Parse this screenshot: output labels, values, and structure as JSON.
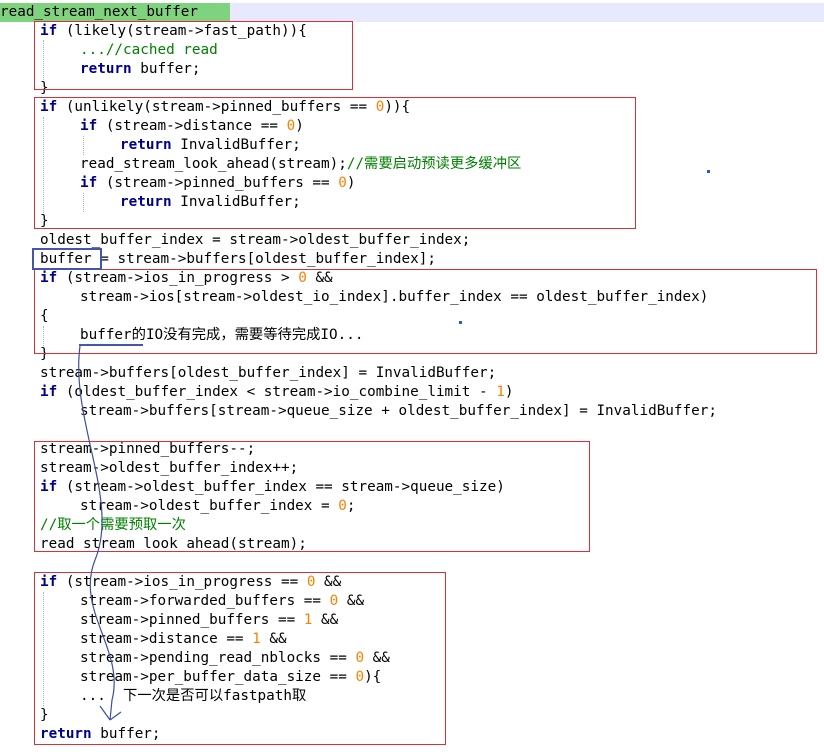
{
  "function_title": "read_stream_next_buffer",
  "lines": {
    "l1": "if (likely(stream->fast_path)){",
    "l2": "...//cached read",
    "l3": "return buffer;",
    "l4": "}",
    "l5": "if (unlikely(stream->pinned_buffers == 0)){",
    "l6": "if (stream->distance == 0)",
    "l7": "return InvalidBuffer;",
    "l8_code": "read_stream_look_ahead(stream);",
    "l8_comment": "//需要启动预读更多缓冲区",
    "l9": "if (stream->pinned_buffers == 0)",
    "l10": "return InvalidBuffer;",
    "l11": "}",
    "l12": "oldest_buffer_index = stream->oldest_buffer_index;",
    "l13": "buffer = stream->buffers[oldest_buffer_index];",
    "l14": "if (stream->ios_in_progress > 0 &&",
    "l15": "stream->ios[stream->oldest_io_index].buffer_index == oldest_buffer_index)",
    "l16": "{",
    "l17": "buffer的IO没有完成，需要等待完成IO...",
    "l18": "}",
    "l19": "stream->buffers[oldest_buffer_index] = InvalidBuffer;",
    "l20": "if (oldest_buffer_index < stream->io_combine_limit - 1)",
    "l21": "stream->buffers[stream->queue_size + oldest_buffer_index] = InvalidBuffer;",
    "l22": "stream->pinned_buffers--;",
    "l23": "stream->oldest_buffer_index++;",
    "l24": "if (stream->oldest_buffer_index == stream->queue_size)",
    "l25": "stream->oldest_buffer_index = 0;",
    "l26": "//取一个需要预取一次",
    "l27": "read_stream_look_ahead(stream);",
    "l28": "if (stream->ios_in_progress == 0 &&",
    "l29": "stream->forwarded_buffers == 0 &&",
    "l30": "stream->pinned_buffers == 1 &&",
    "l31": "stream->distance == 1 &&",
    "l32": "stream->pending_read_nblocks == 0 &&",
    "l33": "stream->per_buffer_data_size == 0){",
    "l34": "...  下一次是否可以fastpath取",
    "l35": "}",
    "l36": "return buffer;"
  },
  "colors": {
    "keyword": "#00008b",
    "number": "#ff8000",
    "comment": "#008000",
    "title_bg": "#7fd37f",
    "red_box": "#d9303a",
    "blue_box": "#4455aa"
  }
}
